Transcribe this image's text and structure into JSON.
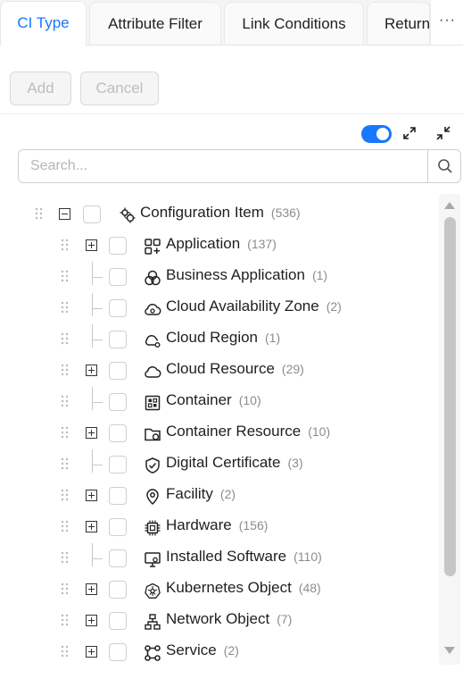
{
  "tabs": [
    {
      "label": "CI Type",
      "active": true
    },
    {
      "label": "Attribute Filter",
      "active": false
    },
    {
      "label": "Link Conditions",
      "active": false
    },
    {
      "label": "Return",
      "active": false
    }
  ],
  "tab_more_label": "···",
  "toolbar": {
    "add_label": "Add",
    "cancel_label": "Cancel"
  },
  "toggle": {
    "on": true,
    "accent": "#1677ff"
  },
  "search": {
    "placeholder": "Search...",
    "value": ""
  },
  "tree": {
    "root": {
      "label": "Configuration Item",
      "count": "(536)",
      "icon": "ci-icon",
      "expanded": true
    },
    "children": [
      {
        "label": "Application",
        "count": "(137)",
        "icon": "application-icon",
        "expandable": true
      },
      {
        "label": "Business Application",
        "count": "(1)",
        "icon": "business-application-icon",
        "expandable": false
      },
      {
        "label": "Cloud Availability Zone",
        "count": "(2)",
        "icon": "cloud-zone-icon",
        "expandable": false
      },
      {
        "label": "Cloud Region",
        "count": "(1)",
        "icon": "cloud-region-icon",
        "expandable": false
      },
      {
        "label": "Cloud Resource",
        "count": "(29)",
        "icon": "cloud-icon",
        "expandable": true
      },
      {
        "label": "Container",
        "count": "(10)",
        "icon": "container-icon",
        "expandable": false
      },
      {
        "label": "Container Resource",
        "count": "(10)",
        "icon": "folder-icon",
        "expandable": true
      },
      {
        "label": "Digital Certificate",
        "count": "(3)",
        "icon": "shield-check-icon",
        "expandable": false
      },
      {
        "label": "Facility",
        "count": "(2)",
        "icon": "location-pin-icon",
        "expandable": true
      },
      {
        "label": "Hardware",
        "count": "(156)",
        "icon": "chip-icon",
        "expandable": true
      },
      {
        "label": "Installed Software",
        "count": "(110)",
        "icon": "monitor-icon",
        "expandable": false
      },
      {
        "label": "Kubernetes Object",
        "count": "(48)",
        "icon": "kubernetes-icon",
        "expandable": true
      },
      {
        "label": "Network Object",
        "count": "(7)",
        "icon": "network-icon",
        "expandable": true
      },
      {
        "label": "Service",
        "count": "(2)",
        "icon": "service-icon",
        "expandable": true
      }
    ]
  }
}
